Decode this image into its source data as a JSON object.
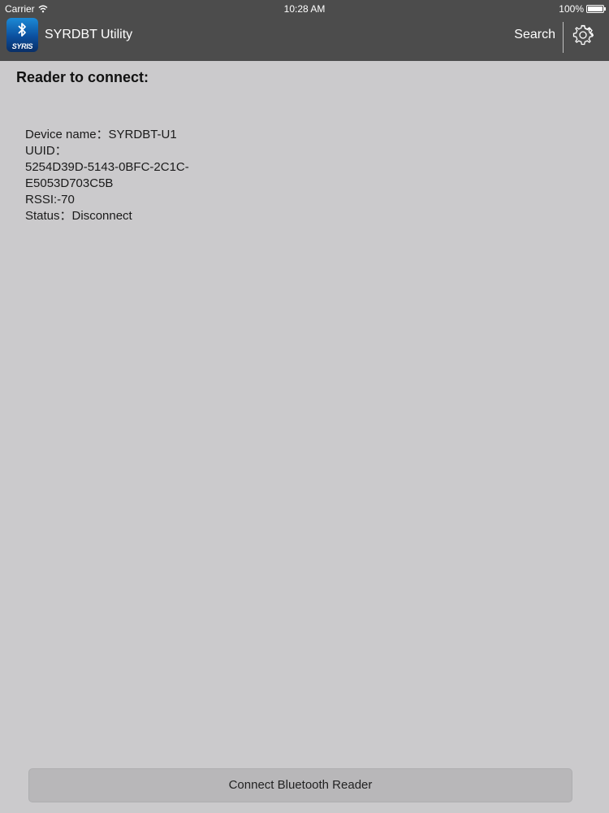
{
  "status_bar": {
    "carrier": "Carrier",
    "time": "10:28 AM",
    "battery": "100%"
  },
  "nav": {
    "app_icon_text": "SYRIS",
    "title": "SYRDBT Utility",
    "search_label": "Search",
    "settings_icon": "gear-icon"
  },
  "main": {
    "section_title": "Reader to connect:",
    "device": {
      "name_line": "Device name：SYRDBT-U1",
      "uuid_label": "UUID：",
      "uuid_value_1": "5254D39D-5143-0BFC-2C1C-",
      "uuid_value_2": "E5053D703C5B",
      "rssi_line": "RSSI:-70",
      "status_line": "Status：Disconnect"
    }
  },
  "footer": {
    "connect_label": "Connect Bluetooth Reader"
  },
  "colors": {
    "bar_background": "#4c4c4c",
    "page_background": "#cbcacc",
    "button_background": "#b8b7b9"
  }
}
